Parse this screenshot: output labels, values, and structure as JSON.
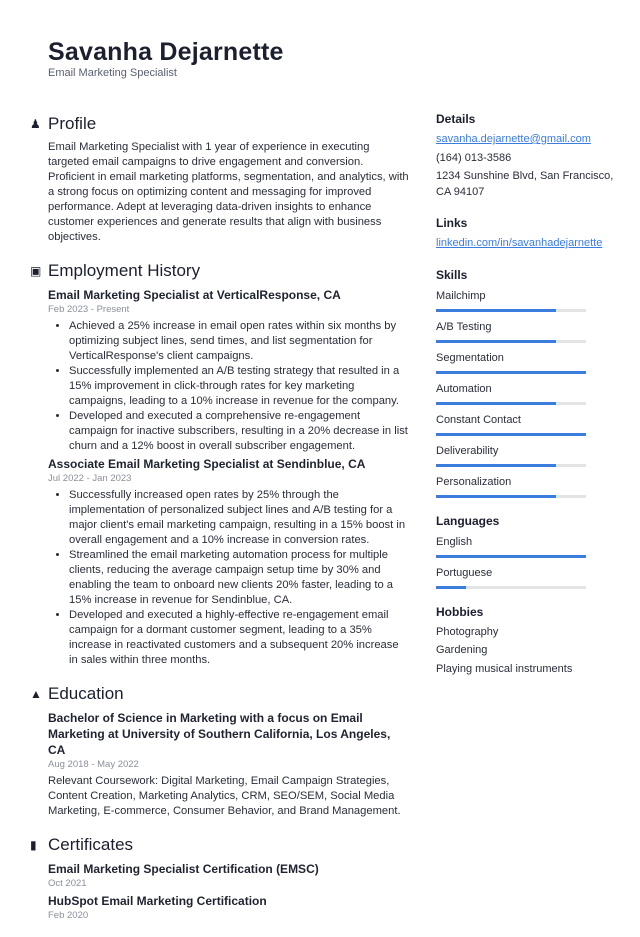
{
  "header": {
    "name": "Savanha Dejarnette",
    "title": "Email Marketing Specialist"
  },
  "profile": {
    "title": "Profile",
    "icon": "person-icon",
    "text": "Email Marketing Specialist with 1 year of experience in executing targeted email campaigns to drive engagement and conversion. Proficient in email marketing platforms, segmentation, and analytics, with a strong focus on optimizing content and messaging for improved performance. Adept at leveraging data-driven insights to enhance customer experiences and generate results that align with business objectives."
  },
  "employment": {
    "title": "Employment History",
    "icon": "briefcase-icon",
    "jobs": [
      {
        "title": "Email Marketing Specialist at VerticalResponse, CA",
        "date": "Feb 2023 - Present",
        "bullets": [
          "Achieved a 25% increase in email open rates within six months by optimizing subject lines, send times, and list segmentation for VerticalResponse's client campaigns.",
          "Successfully implemented an A/B testing strategy that resulted in a 15% improvement in click-through rates for key marketing campaigns, leading to a 10% increase in revenue for the company.",
          "Developed and executed a comprehensive re-engagement campaign for inactive subscribers, resulting in a 20% decrease in list churn and a 12% boost in overall subscriber engagement."
        ]
      },
      {
        "title": "Associate Email Marketing Specialist at Sendinblue, CA",
        "date": "Jul 2022 - Jan 2023",
        "bullets": [
          "Successfully increased open rates by 25% through the implementation of personalized subject lines and A/B testing for a major client's email marketing campaign, resulting in a 15% boost in overall engagement and a 10% increase in conversion rates.",
          "Streamlined the email marketing automation process for multiple clients, reducing the average campaign setup time by 30% and enabling the team to onboard new clients 20% faster, leading to a 15% increase in revenue for Sendinblue, CA.",
          "Developed and executed a highly-effective re-engagement email campaign for a dormant customer segment, leading to a 35% increase in reactivated customers and a subsequent 20% increase in sales within three months."
        ]
      }
    ]
  },
  "education": {
    "title": "Education",
    "icon": "graduation-cap-icon",
    "items": [
      {
        "title": "Bachelor of Science in Marketing with a focus on Email Marketing at University of Southern California, Los Angeles, CA",
        "date": "Aug 2018 - May 2022",
        "text": "Relevant Coursework: Digital Marketing, Email Campaign Strategies, Content Creation, Marketing Analytics, CRM, SEO/SEM, Social Media Marketing, E-commerce, Consumer Behavior, and Brand Management."
      }
    ]
  },
  "certificates": {
    "title": "Certificates",
    "icon": "clipboard-icon",
    "items": [
      {
        "title": "Email Marketing Specialist Certification (EMSC)",
        "date": "Oct 2021"
      },
      {
        "title": "HubSpot Email Marketing Certification",
        "date": "Feb 2020"
      }
    ]
  },
  "details": {
    "title": "Details",
    "email": "savanha.dejarnette@gmail.com",
    "phone": "(164) 013-3586",
    "address": "1234 Sunshine Blvd, San Francisco, CA 94107"
  },
  "links": {
    "title": "Links",
    "items": [
      "linkedin.com/in/savanhadejarnette"
    ]
  },
  "skills": {
    "title": "Skills",
    "items": [
      {
        "label": "Mailchimp",
        "level": 0.8
      },
      {
        "label": "A/B Testing",
        "level": 0.8
      },
      {
        "label": "Segmentation",
        "level": 1.0
      },
      {
        "label": "Automation",
        "level": 0.8
      },
      {
        "label": "Constant Contact",
        "level": 1.0
      },
      {
        "label": "Deliverability",
        "level": 0.8
      },
      {
        "label": "Personalization",
        "level": 0.8
      }
    ]
  },
  "languages": {
    "title": "Languages",
    "items": [
      {
        "label": "English",
        "level": 1.0
      },
      {
        "label": "Portuguese",
        "level": 0.2
      }
    ]
  },
  "hobbies": {
    "title": "Hobbies",
    "items": [
      "Photography",
      "Gardening",
      "Playing musical instruments"
    ]
  },
  "colors": {
    "accent": "#3b7ddd",
    "track": "#e3e4e6"
  }
}
